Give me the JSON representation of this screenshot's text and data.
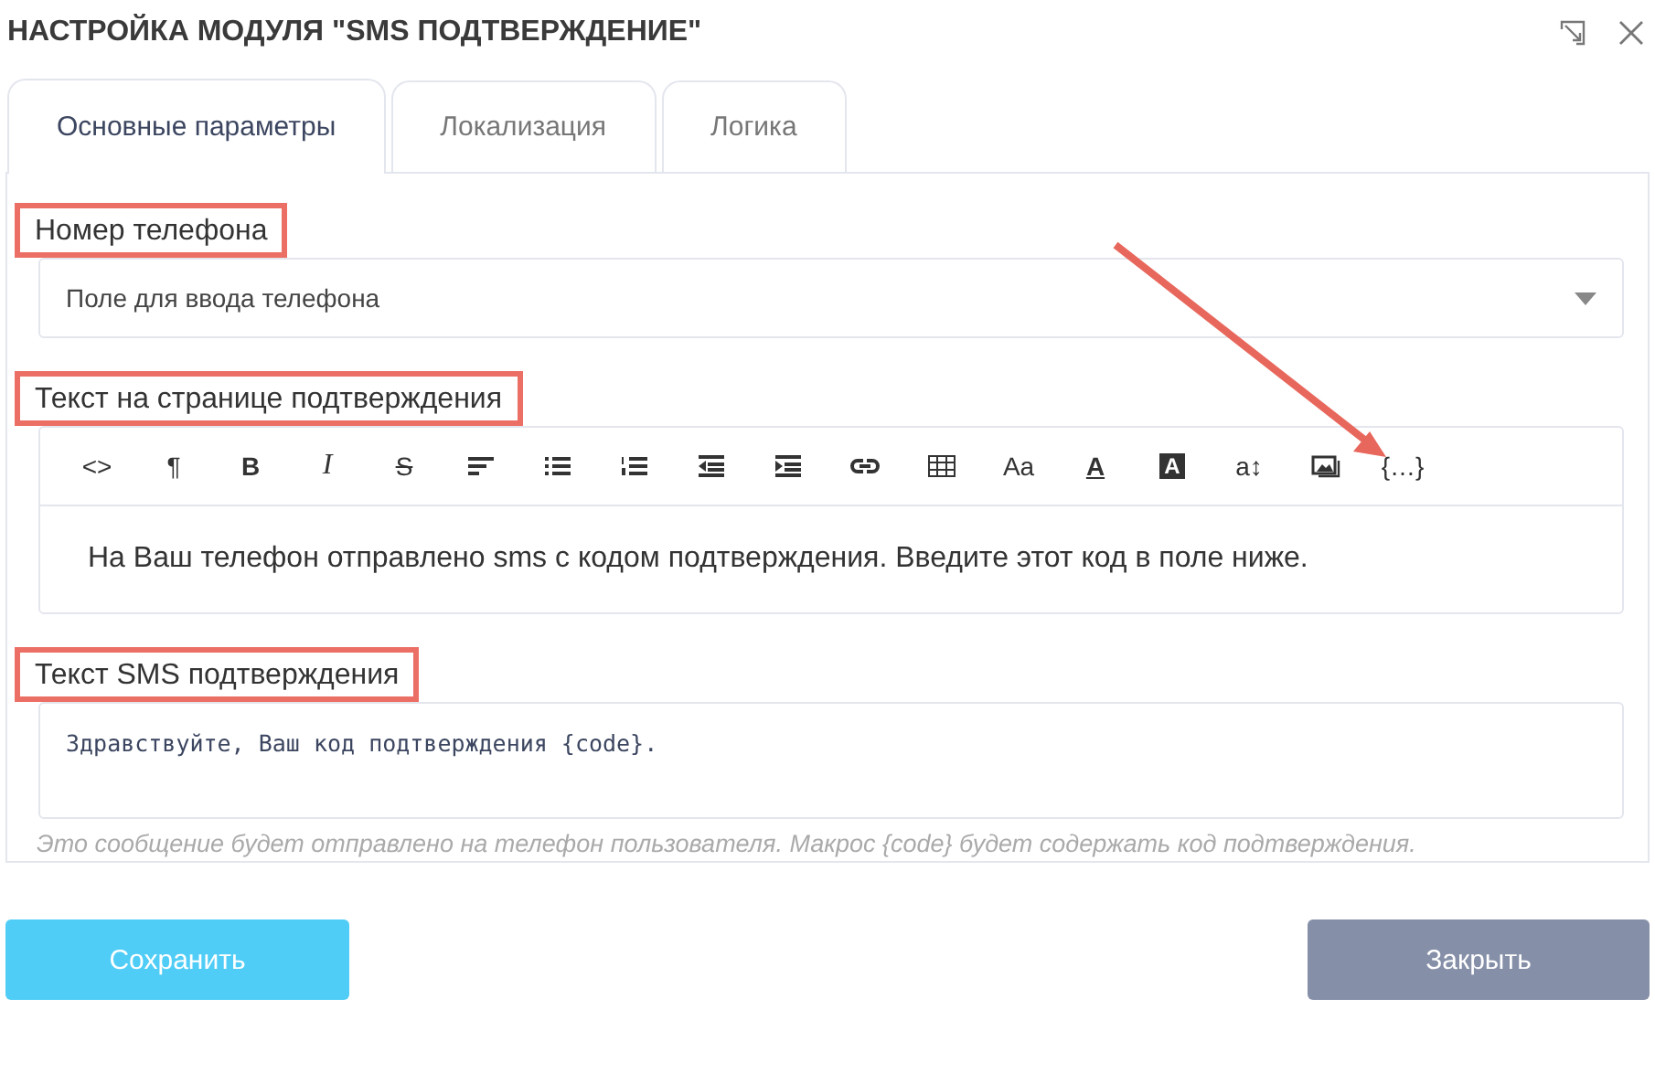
{
  "window": {
    "title": "НАСТРОЙКА МОДУЛЯ \"SMS ПОДТВЕРЖДЕНИЕ\""
  },
  "tabs": [
    {
      "label": "Основные параметры",
      "selected": true
    },
    {
      "label": "Локализация",
      "selected": false
    },
    {
      "label": "Логика",
      "selected": false
    }
  ],
  "phone": {
    "label": "Номер телефона",
    "highlighted": true,
    "value": "Поле для ввода телефона"
  },
  "page_text": {
    "label": "Текст на странице подтверждения",
    "highlighted": true,
    "toolbar": [
      {
        "kind": "glyph",
        "text": "<>"
      },
      {
        "kind": "glyph",
        "text": "¶"
      },
      {
        "kind": "bold",
        "text": "B"
      },
      {
        "kind": "italic",
        "text": "I"
      },
      {
        "kind": "strike",
        "text": "S"
      },
      {
        "kind": "align"
      },
      {
        "kind": "bullets"
      },
      {
        "kind": "numbers"
      },
      {
        "kind": "outdent"
      },
      {
        "kind": "indent"
      },
      {
        "kind": "link"
      },
      {
        "kind": "table"
      },
      {
        "kind": "glyph",
        "text": "Aa"
      },
      {
        "kind": "underline",
        "text": "A"
      },
      {
        "kind": "inverse",
        "text": "A"
      },
      {
        "kind": "glyph",
        "text": "a↕"
      },
      {
        "kind": "image"
      },
      {
        "kind": "glyph",
        "text": "{…}"
      }
    ],
    "value": "На Ваш телефон отправлено sms с кодом подтверждения. Введите этот код в поле ниже."
  },
  "sms_text": {
    "label": "Текст SMS подтверждения",
    "highlighted": true,
    "value": "Здравствуйте, Ваш код подтверждения {code}.",
    "hint": "Это сообщение будет отправлено на телефон пользователя. Макрос {code} будет содержать код подтверждения."
  },
  "buttons": [
    {
      "label": "Сохранить",
      "kind": "primary"
    },
    {
      "label": "Закрыть",
      "kind": "secondary"
    }
  ]
}
